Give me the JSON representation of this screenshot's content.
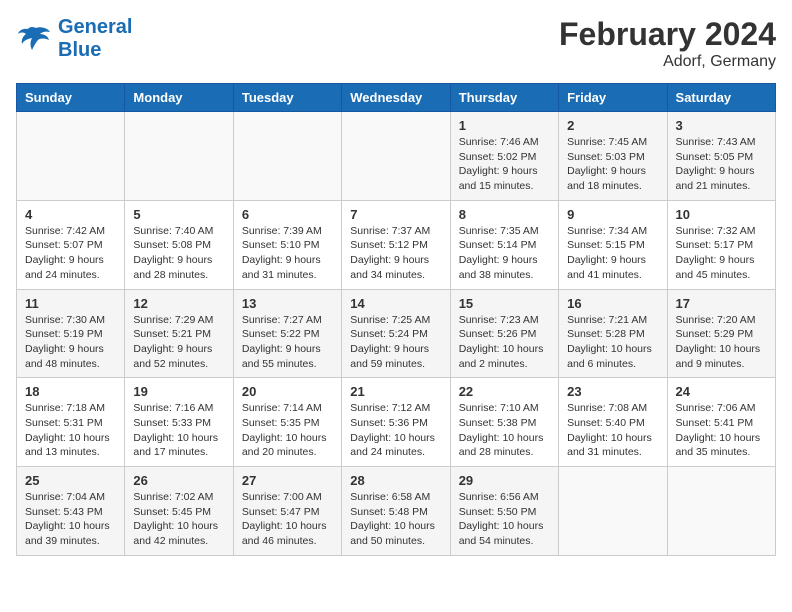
{
  "header": {
    "logo_line1": "General",
    "logo_line2": "Blue",
    "title": "February 2024",
    "subtitle": "Adorf, Germany"
  },
  "days_of_week": [
    "Sunday",
    "Monday",
    "Tuesday",
    "Wednesday",
    "Thursday",
    "Friday",
    "Saturday"
  ],
  "weeks": [
    [
      {
        "day": "",
        "info": ""
      },
      {
        "day": "",
        "info": ""
      },
      {
        "day": "",
        "info": ""
      },
      {
        "day": "",
        "info": ""
      },
      {
        "day": "1",
        "info": "Sunrise: 7:46 AM\nSunset: 5:02 PM\nDaylight: 9 hours\nand 15 minutes."
      },
      {
        "day": "2",
        "info": "Sunrise: 7:45 AM\nSunset: 5:03 PM\nDaylight: 9 hours\nand 18 minutes."
      },
      {
        "day": "3",
        "info": "Sunrise: 7:43 AM\nSunset: 5:05 PM\nDaylight: 9 hours\nand 21 minutes."
      }
    ],
    [
      {
        "day": "4",
        "info": "Sunrise: 7:42 AM\nSunset: 5:07 PM\nDaylight: 9 hours\nand 24 minutes."
      },
      {
        "day": "5",
        "info": "Sunrise: 7:40 AM\nSunset: 5:08 PM\nDaylight: 9 hours\nand 28 minutes."
      },
      {
        "day": "6",
        "info": "Sunrise: 7:39 AM\nSunset: 5:10 PM\nDaylight: 9 hours\nand 31 minutes."
      },
      {
        "day": "7",
        "info": "Sunrise: 7:37 AM\nSunset: 5:12 PM\nDaylight: 9 hours\nand 34 minutes."
      },
      {
        "day": "8",
        "info": "Sunrise: 7:35 AM\nSunset: 5:14 PM\nDaylight: 9 hours\nand 38 minutes."
      },
      {
        "day": "9",
        "info": "Sunrise: 7:34 AM\nSunset: 5:15 PM\nDaylight: 9 hours\nand 41 minutes."
      },
      {
        "day": "10",
        "info": "Sunrise: 7:32 AM\nSunset: 5:17 PM\nDaylight: 9 hours\nand 45 minutes."
      }
    ],
    [
      {
        "day": "11",
        "info": "Sunrise: 7:30 AM\nSunset: 5:19 PM\nDaylight: 9 hours\nand 48 minutes."
      },
      {
        "day": "12",
        "info": "Sunrise: 7:29 AM\nSunset: 5:21 PM\nDaylight: 9 hours\nand 52 minutes."
      },
      {
        "day": "13",
        "info": "Sunrise: 7:27 AM\nSunset: 5:22 PM\nDaylight: 9 hours\nand 55 minutes."
      },
      {
        "day": "14",
        "info": "Sunrise: 7:25 AM\nSunset: 5:24 PM\nDaylight: 9 hours\nand 59 minutes."
      },
      {
        "day": "15",
        "info": "Sunrise: 7:23 AM\nSunset: 5:26 PM\nDaylight: 10 hours\nand 2 minutes."
      },
      {
        "day": "16",
        "info": "Sunrise: 7:21 AM\nSunset: 5:28 PM\nDaylight: 10 hours\nand 6 minutes."
      },
      {
        "day": "17",
        "info": "Sunrise: 7:20 AM\nSunset: 5:29 PM\nDaylight: 10 hours\nand 9 minutes."
      }
    ],
    [
      {
        "day": "18",
        "info": "Sunrise: 7:18 AM\nSunset: 5:31 PM\nDaylight: 10 hours\nand 13 minutes."
      },
      {
        "day": "19",
        "info": "Sunrise: 7:16 AM\nSunset: 5:33 PM\nDaylight: 10 hours\nand 17 minutes."
      },
      {
        "day": "20",
        "info": "Sunrise: 7:14 AM\nSunset: 5:35 PM\nDaylight: 10 hours\nand 20 minutes."
      },
      {
        "day": "21",
        "info": "Sunrise: 7:12 AM\nSunset: 5:36 PM\nDaylight: 10 hours\nand 24 minutes."
      },
      {
        "day": "22",
        "info": "Sunrise: 7:10 AM\nSunset: 5:38 PM\nDaylight: 10 hours\nand 28 minutes."
      },
      {
        "day": "23",
        "info": "Sunrise: 7:08 AM\nSunset: 5:40 PM\nDaylight: 10 hours\nand 31 minutes."
      },
      {
        "day": "24",
        "info": "Sunrise: 7:06 AM\nSunset: 5:41 PM\nDaylight: 10 hours\nand 35 minutes."
      }
    ],
    [
      {
        "day": "25",
        "info": "Sunrise: 7:04 AM\nSunset: 5:43 PM\nDaylight: 10 hours\nand 39 minutes."
      },
      {
        "day": "26",
        "info": "Sunrise: 7:02 AM\nSunset: 5:45 PM\nDaylight: 10 hours\nand 42 minutes."
      },
      {
        "day": "27",
        "info": "Sunrise: 7:00 AM\nSunset: 5:47 PM\nDaylight: 10 hours\nand 46 minutes."
      },
      {
        "day": "28",
        "info": "Sunrise: 6:58 AM\nSunset: 5:48 PM\nDaylight: 10 hours\nand 50 minutes."
      },
      {
        "day": "29",
        "info": "Sunrise: 6:56 AM\nSunset: 5:50 PM\nDaylight: 10 hours\nand 54 minutes."
      },
      {
        "day": "",
        "info": ""
      },
      {
        "day": "",
        "info": ""
      }
    ]
  ]
}
